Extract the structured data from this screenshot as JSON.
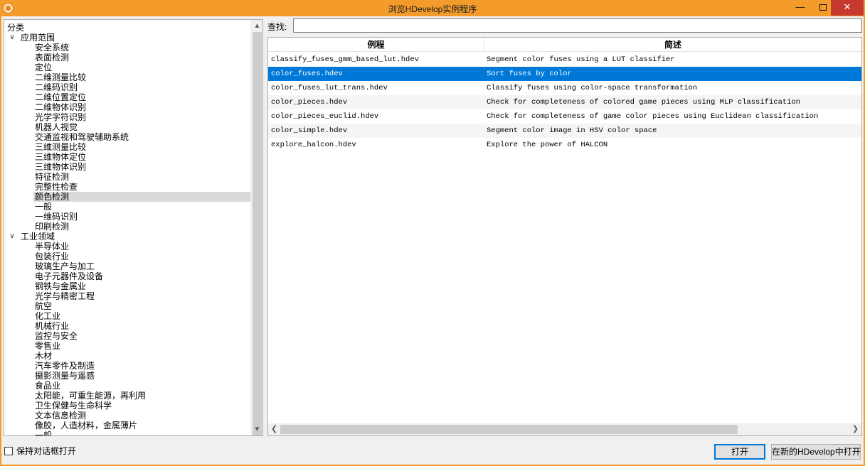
{
  "window": {
    "title": "浏览HDevelop实例程序",
    "min_glyph": "—",
    "close_glyph": "✕"
  },
  "tree": {
    "header": "分类",
    "groups": [
      {
        "label": "应用范围",
        "expanded": true,
        "items": [
          "安全系统",
          "表面检测",
          "定位",
          "二维测量比较",
          "二维码识别",
          "二维位置定位",
          "二维物体识别",
          "光学字符识别",
          "机器人视觉",
          "交通监视和驾驶辅助系统",
          "三维测量比较",
          "三维物体定位",
          "三维物体识别",
          "特征检测",
          "完整性检查",
          "颜色检测",
          "一般",
          "一维码识别",
          "印刷检测"
        ]
      },
      {
        "label": "工业领域",
        "expanded": true,
        "items": [
          "半导体业",
          "包装行业",
          "玻璃生产与加工",
          "电子元器件及设备",
          "钢铁与金属业",
          "光学与精密工程",
          "航空",
          "化工业",
          "机械行业",
          "监控与安全",
          "零售业",
          "木材",
          "汽车零件及制造",
          "摄影测量与遥感",
          "食品业",
          "太阳能，可重生能源，再利用",
          "卫生保健与生命科学",
          "文本信息检测",
          "像胶，人造材料，金属薄片",
          "一般"
        ]
      }
    ],
    "selected_item": "颜色检测",
    "toggle_glyph": "∨",
    "scroll_up": "▲",
    "scroll_down": "▼"
  },
  "search": {
    "label": "查找:",
    "value": ""
  },
  "table": {
    "columns": [
      "例程",
      "简述"
    ],
    "rows": [
      {
        "file": "classify_fuses_gmm_based_lut.hdev",
        "desc": "Segment color fuses using a LUT classifier"
      },
      {
        "file": "color_fuses.hdev",
        "desc": "Sort fuses by color"
      },
      {
        "file": "color_fuses_lut_trans.hdev",
        "desc": "Classify fuses using color-space transformation"
      },
      {
        "file": "color_pieces.hdev",
        "desc": "Check for completeness of colored game pieces using MLP classification"
      },
      {
        "file": "color_pieces_euclid.hdev",
        "desc": "Check for completeness of game color pieces using Euclidean classification"
      },
      {
        "file": "color_simple.hdev",
        "desc": "Segment color image in HSV color space"
      },
      {
        "file": "explore_halcon.hdev",
        "desc": "Explore the power of HALCON"
      }
    ],
    "selected_row": 1,
    "scroll_left": "❮",
    "scroll_right": "❯"
  },
  "footer": {
    "keep_open_label": "保持对话框打开",
    "open_button": "打开",
    "open_new_button": "在新的HDevelop中打开"
  },
  "colors": {
    "accent": "#f39c2c",
    "selection": "#0078d7"
  }
}
